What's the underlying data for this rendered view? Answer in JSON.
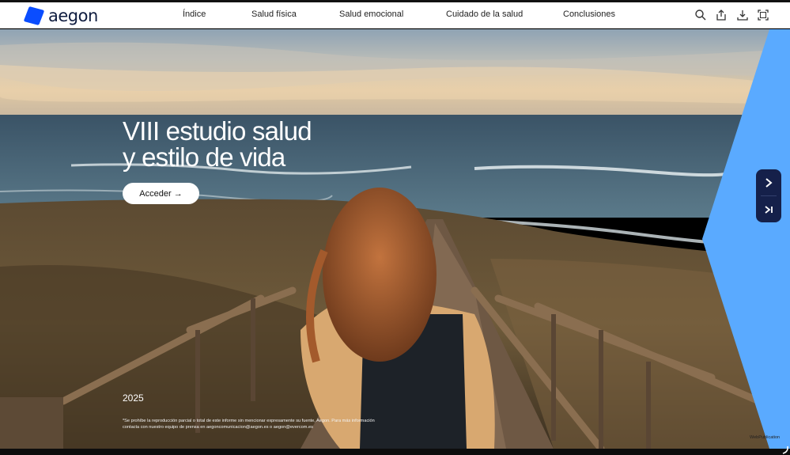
{
  "brand": {
    "name": "aegon",
    "mark_color": "#0a4dff"
  },
  "nav": {
    "items": [
      {
        "label": "Índice"
      },
      {
        "label": "Salud física"
      },
      {
        "label": "Salud emocional"
      },
      {
        "label": "Cuidado de la salud"
      },
      {
        "label": "Conclusiones"
      }
    ]
  },
  "tools": [
    "search-icon",
    "share-icon",
    "download-icon",
    "fullscreen-icon"
  ],
  "hero": {
    "title_line1": "VIII estudio salud",
    "title_line2": "y estilo de vida",
    "cta": "Acceder →",
    "year": "2025",
    "disclaimer": "*Se prohíbe la reproducción parcial o total de este informe sin mencionar expresamente su fuente, Aegon. Para más información contacta con nuestro equipo de prensa en aegoncomunicacion@aegon.es o aegon@evercom.es"
  },
  "side_nav": {
    "next_icon": "chevron-right-icon",
    "last_icon": "skip-to-end-icon"
  },
  "footer": {
    "credit": "WebPublication"
  },
  "colors": {
    "accent": "#5aaaff",
    "nav_dark": "#15204a"
  }
}
